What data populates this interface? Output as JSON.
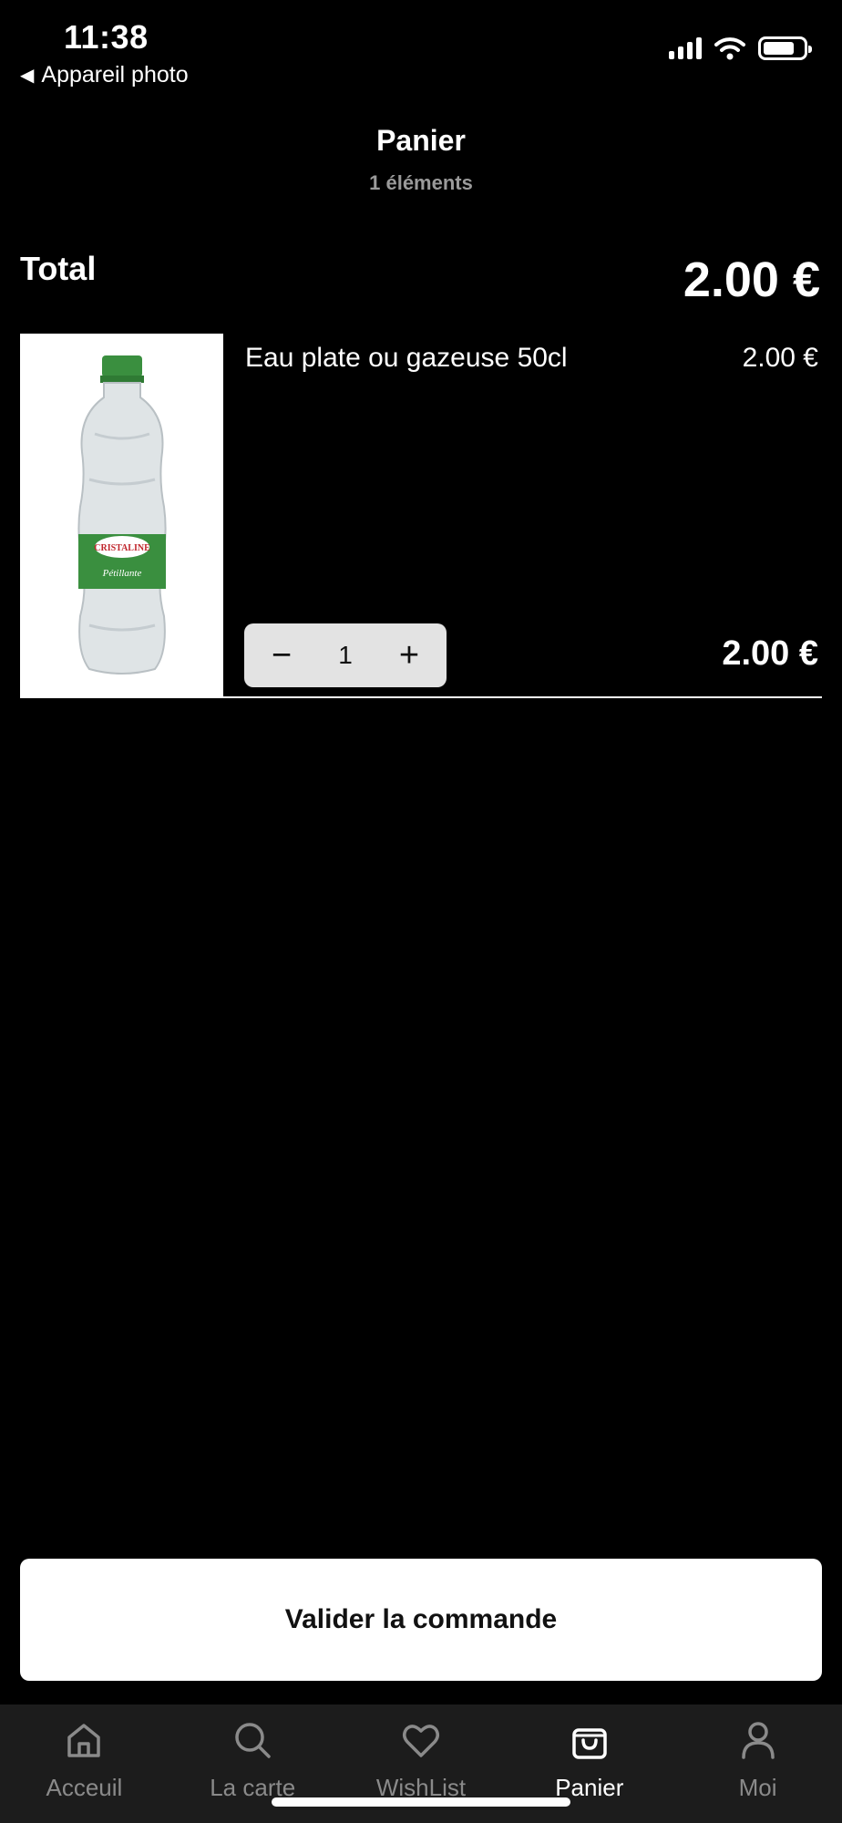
{
  "status": {
    "time": "11:38",
    "back_label": "Appareil photo"
  },
  "header": {
    "title": "Panier",
    "subtitle": "1 éléments"
  },
  "total": {
    "label": "Total",
    "value": "2.00 €"
  },
  "cart_items": [
    {
      "name": "Eau plate ou gazeuse 50cl",
      "unit_price": "2.00 €",
      "quantity": "1",
      "line_total": "2.00 €",
      "image_brand": "CRISTALINE",
      "image_tagline": "Pétillante"
    }
  ],
  "stepper": {
    "minus_label": "−",
    "plus_label": "+"
  },
  "checkout": {
    "label": "Valider la commande"
  },
  "tabs": [
    {
      "label": "Acceuil",
      "icon": "home-icon",
      "active": false
    },
    {
      "label": "La carte",
      "icon": "search-icon",
      "active": false
    },
    {
      "label": "WishList",
      "icon": "heart-icon",
      "active": false
    },
    {
      "label": "Panier",
      "icon": "bag-icon",
      "active": true
    },
    {
      "label": "Moi",
      "icon": "user-icon",
      "active": false
    }
  ],
  "colors": {
    "background": "#000000",
    "tabbar": "#1c1c1c",
    "stepper": "#e3e3e3",
    "brand_green": "#3a8f3f"
  }
}
